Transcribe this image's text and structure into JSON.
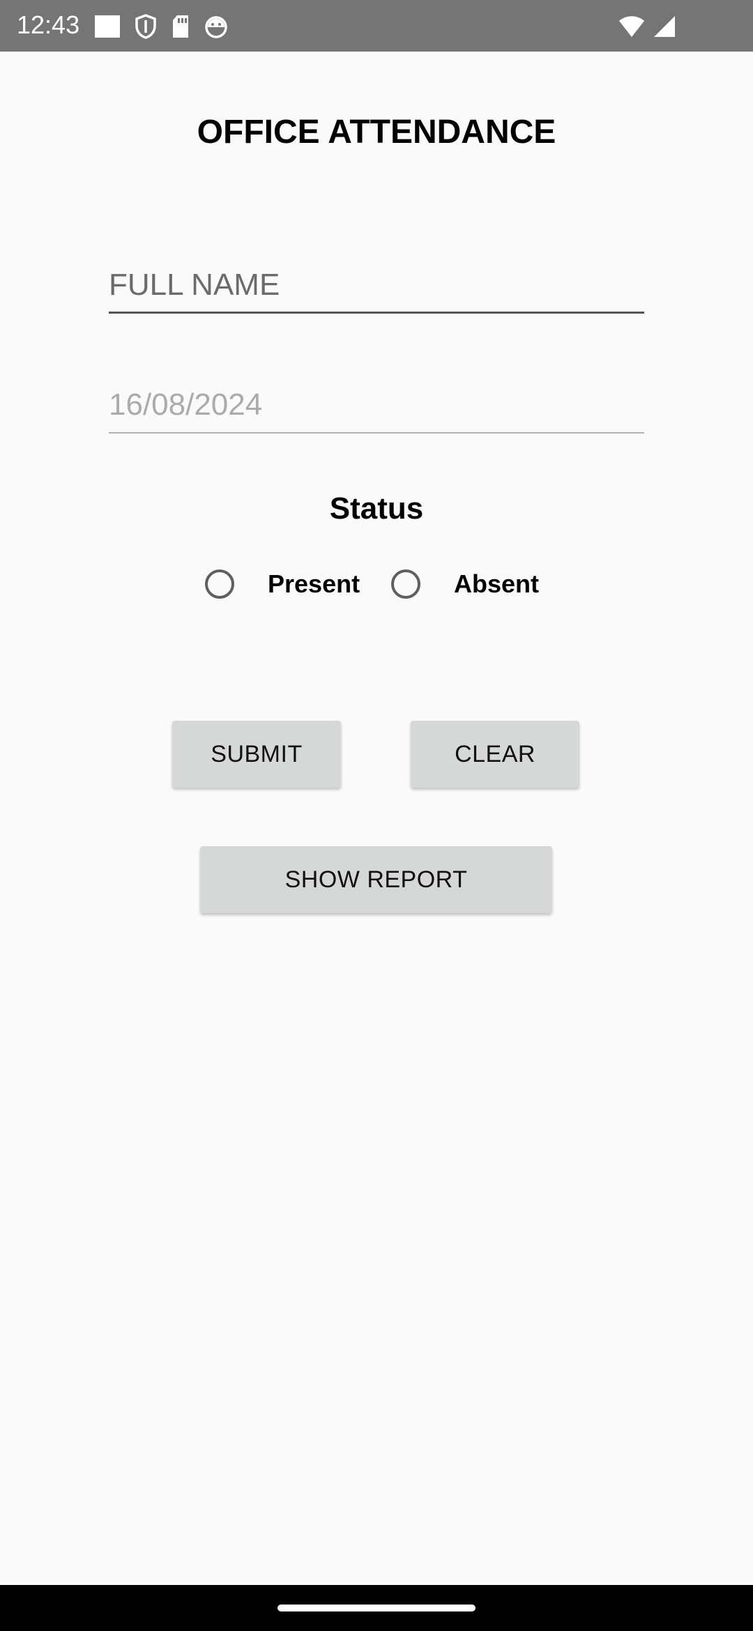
{
  "status_bar": {
    "time": "12:43",
    "left_icons": [
      "square-notification-icon",
      "shield-icon",
      "sd-card-icon",
      "android-debug-icon"
    ],
    "right_icons": [
      "wifi-icon",
      "cellular-signal-icon"
    ]
  },
  "page": {
    "title": "OFFICE ATTENDANCE"
  },
  "form": {
    "name_placeholder": "FULL NAME",
    "name_value": "",
    "date_placeholder": "16/08/2024",
    "status_label": "Status",
    "radio_options": [
      {
        "label": "Present",
        "selected": false
      },
      {
        "label": "Absent",
        "selected": false
      }
    ]
  },
  "buttons": {
    "submit": "SUBMIT",
    "clear": "CLEAR",
    "show_report": "SHOW REPORT"
  },
  "colors": {
    "status_bar": "#757575",
    "background": "#fafafa",
    "button": "#d6d7d7",
    "nav_bar": "#000000"
  }
}
